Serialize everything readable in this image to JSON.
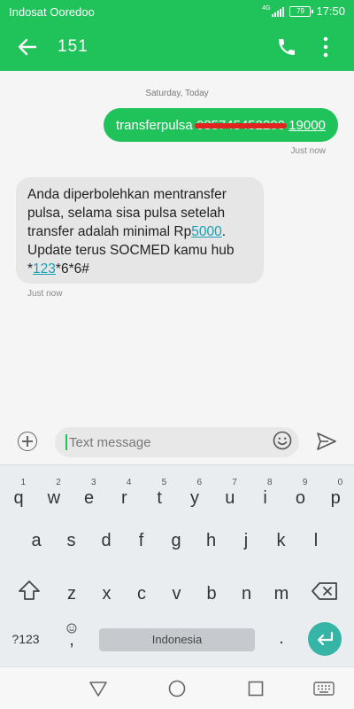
{
  "status_bar": {
    "carrier": "Indosat Ooredoo",
    "network": "4G",
    "battery": "79",
    "time": "17:50"
  },
  "app_bar": {
    "title": "151"
  },
  "conversation": {
    "date_separator": "Saturday, Today",
    "outgoing": {
      "prefix": "transferpulsa",
      "redacted": "085745452200",
      "amount": "19000",
      "time": "Just now"
    },
    "incoming": {
      "line1": "Anda diperbolehkan mentransfer",
      "line2": "pulsa, selama sisa pulsa setelah",
      "line3_prefix": "transfer adalah minimal Rp",
      "line3_link": "5000",
      "line3_suffix": ".",
      "line4": "Update terus SOCMED kamu hub",
      "line5_prefix": "*",
      "line5_link": "123",
      "line5_suffix": "*6*6#",
      "time": "Just now"
    }
  },
  "compose": {
    "placeholder": "Text message"
  },
  "keyboard": {
    "row1": [
      "q",
      "w",
      "e",
      "r",
      "t",
      "y",
      "u",
      "i",
      "o",
      "p"
    ],
    "row1_hints": [
      "1",
      "2",
      "3",
      "4",
      "5",
      "6",
      "7",
      "8",
      "9",
      "0"
    ],
    "row2": [
      "a",
      "s",
      "d",
      "f",
      "g",
      "h",
      "j",
      "k",
      "l"
    ],
    "row3": [
      "z",
      "x",
      "c",
      "v",
      "b",
      "n",
      "m"
    ],
    "symbols": "?123",
    "comma": ",",
    "period": ".",
    "space_label": "Indonesia"
  },
  "colors": {
    "accent": "#1fc35a",
    "strike": "#e0241f",
    "link": "#1a9fb5",
    "enter_key": "#36b4a6"
  }
}
